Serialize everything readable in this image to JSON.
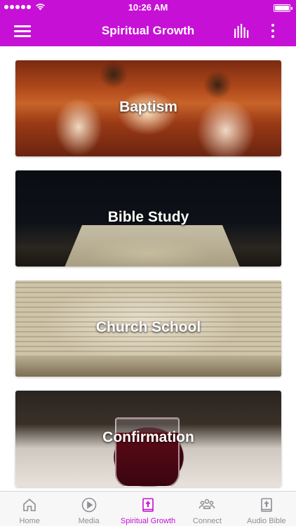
{
  "status_bar": {
    "time": "10:26 AM",
    "battery_level": 1.0
  },
  "app_bar": {
    "title": "Spiritual Growth",
    "menu_icon": "hamburger-icon",
    "equalizer_icon": "equalizer-icon",
    "more_icon": "more-vertical-icon"
  },
  "cards": [
    {
      "label": "Baptism"
    },
    {
      "label": "Bible Study"
    },
    {
      "label": "Church School"
    },
    {
      "label": "Confirmation"
    }
  ],
  "tabs": [
    {
      "label": "Home",
      "icon": "home-icon",
      "active": false
    },
    {
      "label": "Media",
      "icon": "play-icon",
      "active": false
    },
    {
      "label": "Spiritual Growth",
      "icon": "bible-icon",
      "active": true
    },
    {
      "label": "Connect",
      "icon": "people-icon",
      "active": false
    },
    {
      "label": "Audio Bible",
      "icon": "audio-bible-icon",
      "active": false
    }
  ],
  "colors": {
    "accent": "#c710d6",
    "tab_inactive": "#8e8e93",
    "tabbar_bg": "#f7f7f7"
  }
}
